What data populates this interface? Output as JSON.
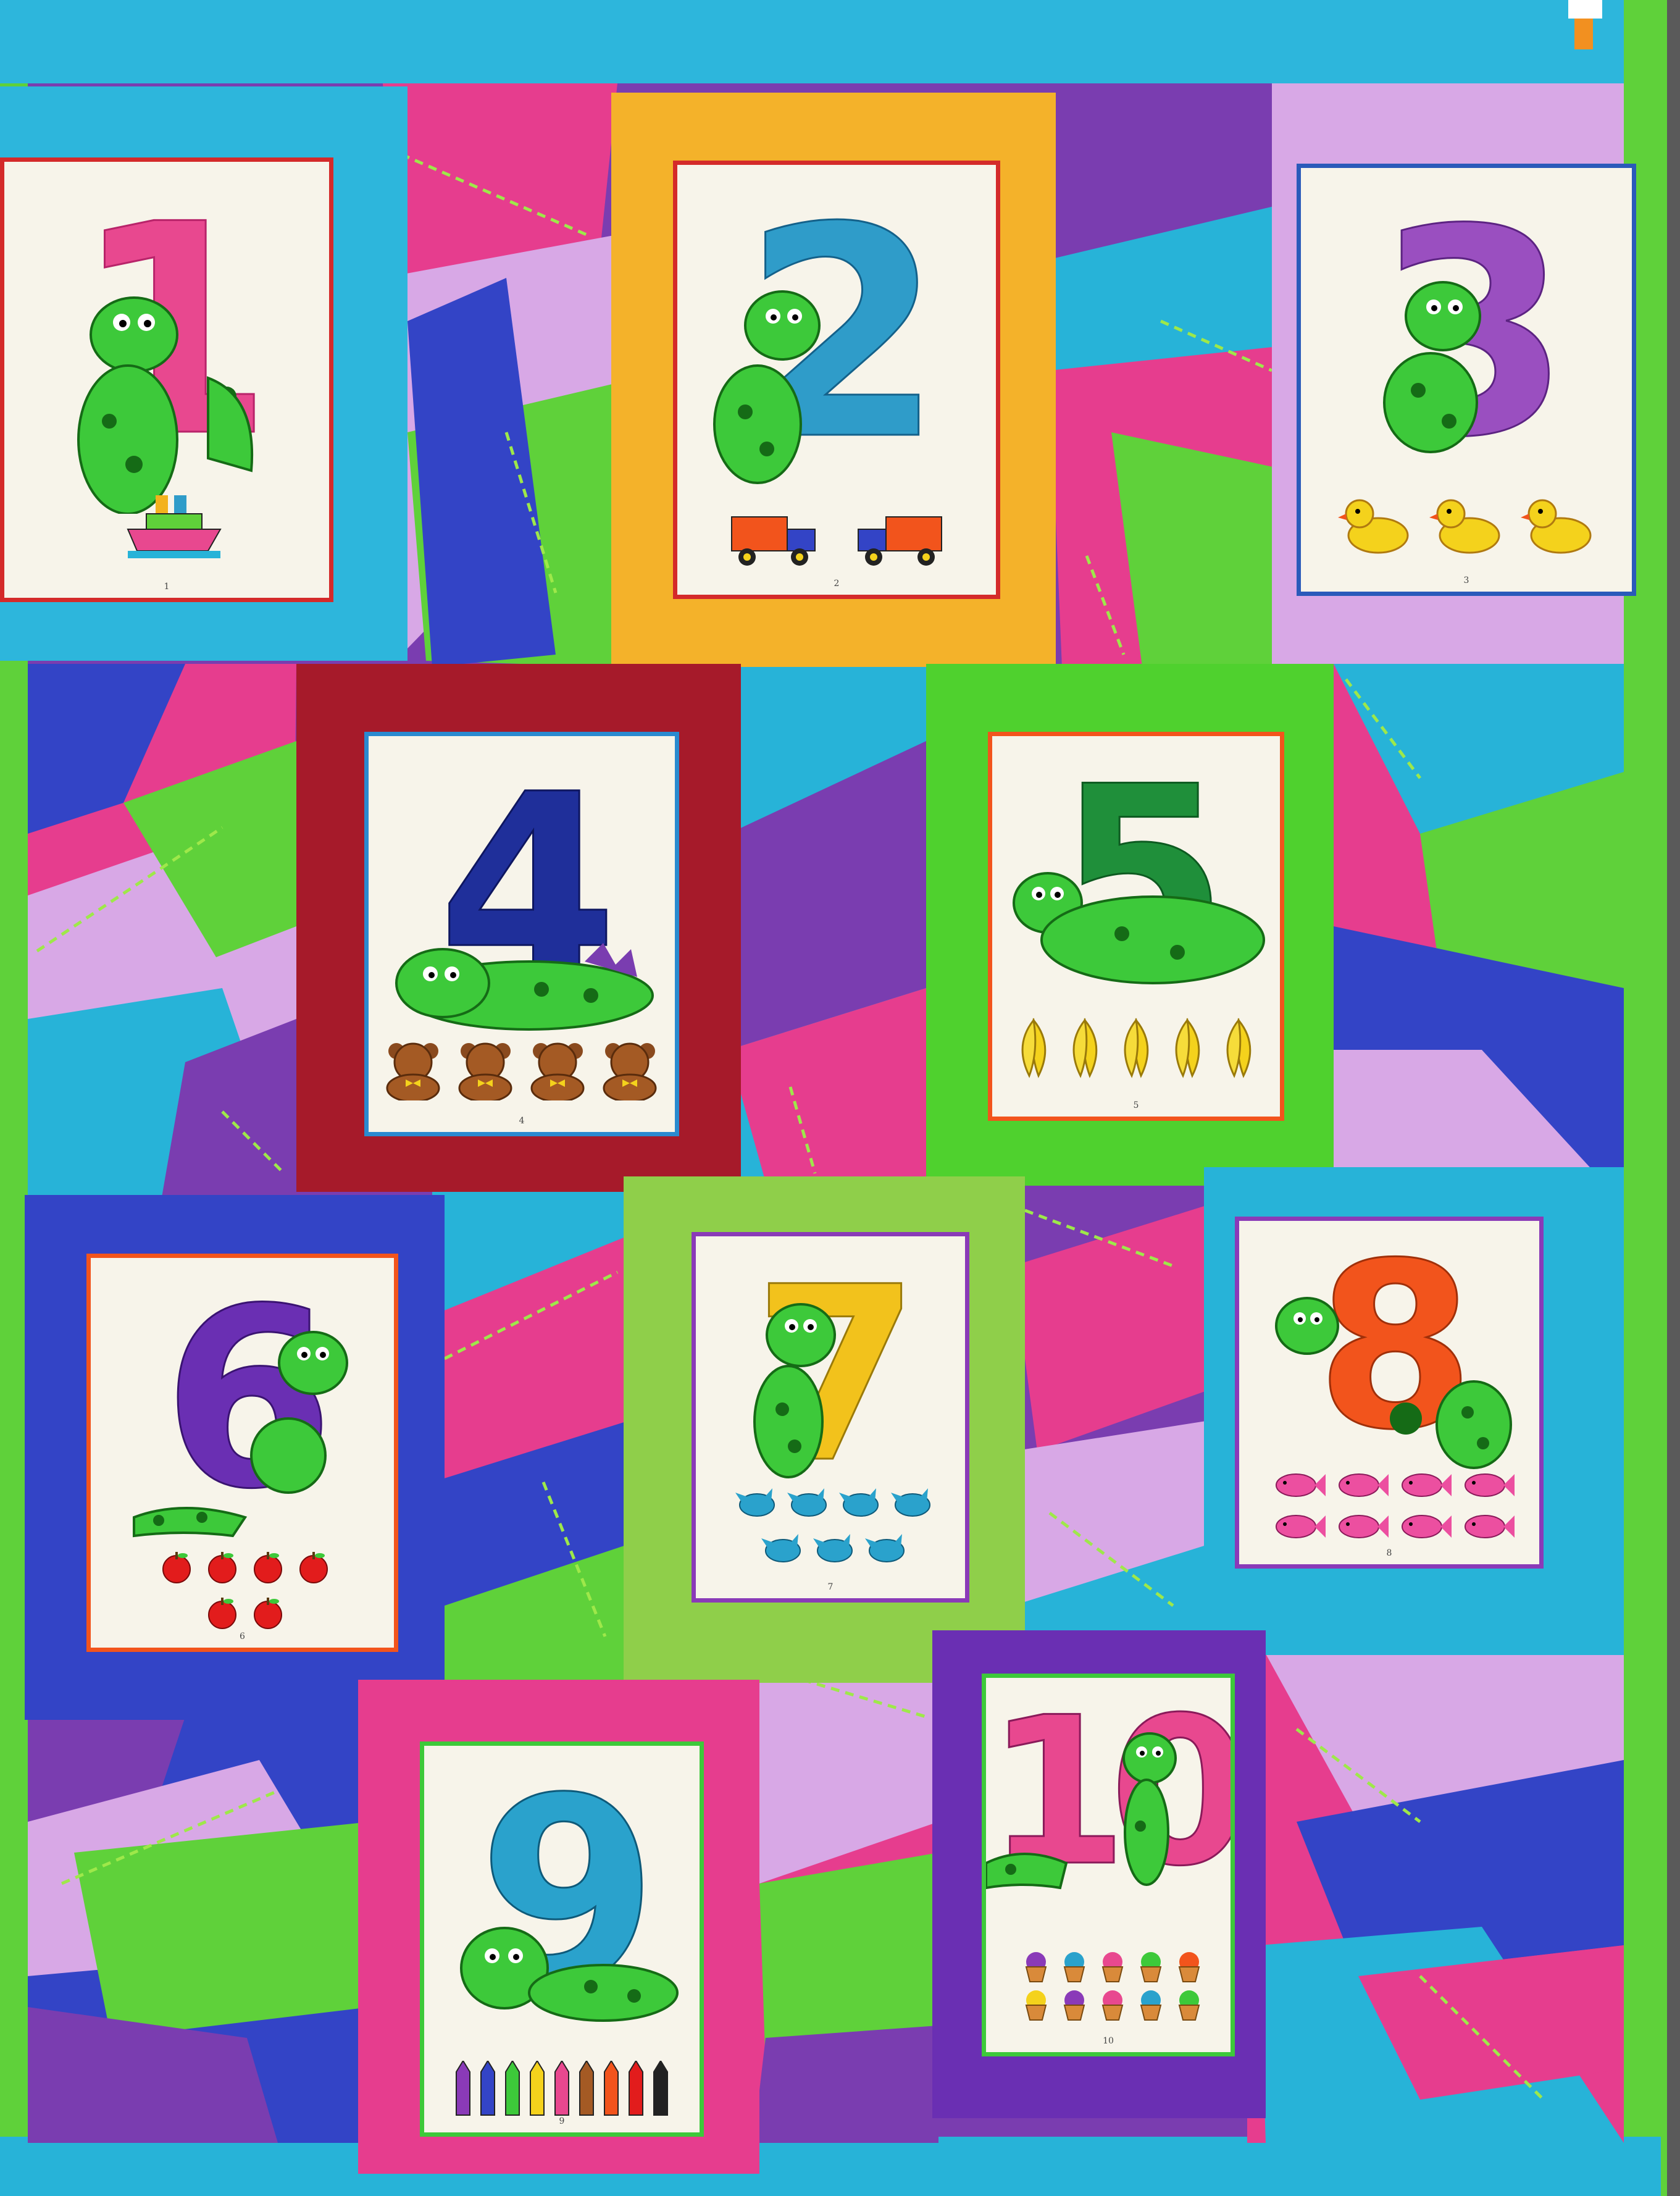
{
  "colors": {
    "turquoise": "#27b3d8",
    "magenta": "#e63d8e",
    "lime": "#5fd13a",
    "purple": "#7a3db0",
    "lilac": "#d8a8e6",
    "royal_blue": "#3344c6",
    "orange": "#f4a21c",
    "maroon": "#a61a2a",
    "panel_white": "#f7f4ea",
    "dino_green": "#3dc93a"
  },
  "panels": [
    {
      "number": "1",
      "caption": "1",
      "numeral_color": "#e8488f",
      "objects": "boat"
    },
    {
      "number": "2",
      "caption": "2",
      "numeral_color": "#2f9cc9",
      "objects": "trucks"
    },
    {
      "number": "3",
      "caption": "3",
      "numeral_color": "#9a4fc0",
      "objects": "ducks"
    },
    {
      "number": "4",
      "caption": "4",
      "numeral_color": "#1f2f9a",
      "objects": "bears"
    },
    {
      "number": "5",
      "caption": "5",
      "numeral_color": "#1f8f3a",
      "objects": "bananas"
    },
    {
      "number": "6",
      "caption": "6",
      "numeral_color": "#6a2fb3",
      "objects": "apples"
    },
    {
      "number": "7",
      "caption": "7",
      "numeral_color": "#f2c21c",
      "objects": "birds"
    },
    {
      "number": "8",
      "caption": "8",
      "numeral_color": "#f2541c",
      "objects": "fish"
    },
    {
      "number": "9",
      "caption": "9",
      "numeral_color": "#2aa2cc",
      "objects": "crayons"
    },
    {
      "number": "10",
      "caption": "10",
      "numeral_color": "#e8488f",
      "objects": "cupcakes"
    }
  ]
}
